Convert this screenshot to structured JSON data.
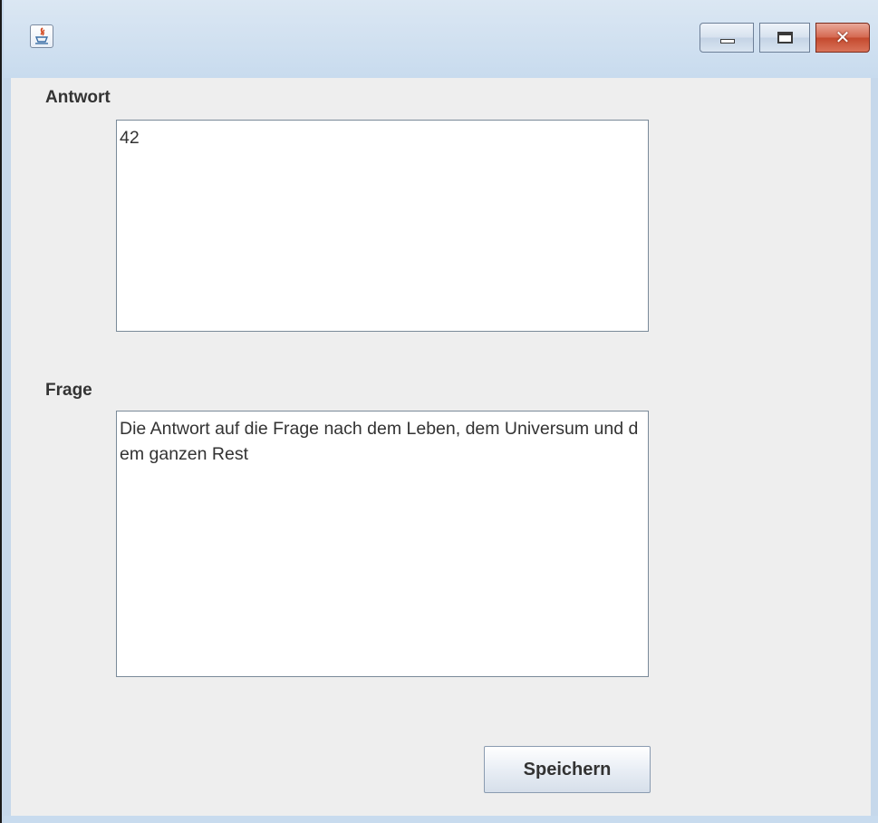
{
  "window": {
    "title": "",
    "controls": {
      "minimize_icon": "minimize-icon",
      "maximize_icon": "maximize-icon",
      "close_icon": "close-icon",
      "close_symbol": "✕"
    }
  },
  "form": {
    "answer_label": "Antwort",
    "answer_value": "42",
    "question_label": "Frage",
    "question_value": "Die Antwort auf die Frage nach dem Leben, dem Universum und dem ganzen Rest",
    "save_label": "Speichern"
  },
  "colors": {
    "close_button": "#c44a2e",
    "panel_background": "#eeeeee"
  }
}
